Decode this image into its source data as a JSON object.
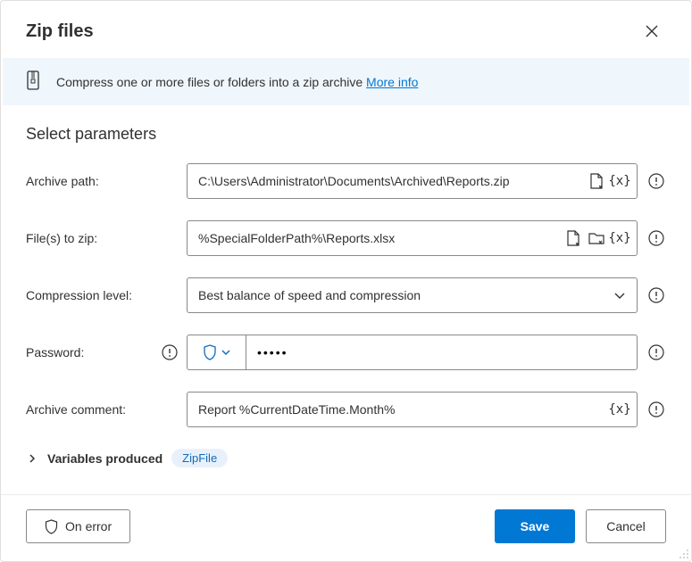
{
  "header": {
    "title": "Zip files"
  },
  "banner": {
    "text": "Compress one or more files or folders into a zip archive",
    "link_label": "More info"
  },
  "section_title": "Select parameters",
  "fields": {
    "archive_path": {
      "label": "Archive path:",
      "value": "C:\\Users\\Administrator\\Documents\\Archived\\Reports.zip"
    },
    "files_to_zip": {
      "label": "File(s) to zip:",
      "value": "%SpecialFolderPath%\\Reports.xlsx"
    },
    "compression": {
      "label": "Compression level:",
      "value": "Best balance of speed and compression"
    },
    "password": {
      "label": "Password:",
      "value": "•••••"
    },
    "comment": {
      "label": "Archive comment:",
      "value": "Report %CurrentDateTime.Month%"
    }
  },
  "variables": {
    "label": "Variables produced",
    "pill": "ZipFile"
  },
  "footer": {
    "on_error": "On error",
    "save": "Save",
    "cancel": "Cancel"
  }
}
